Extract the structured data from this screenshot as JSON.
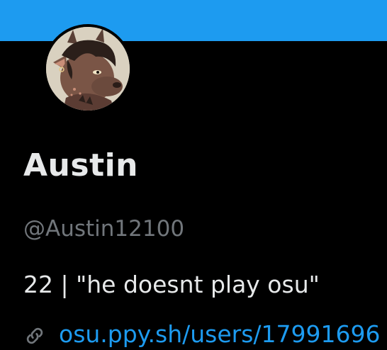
{
  "profile": {
    "display_name": "Austin",
    "handle": "@Austin12100",
    "bio": "22 | \"he doesnt play osu\"",
    "link_text": "osu.ppy.sh/users/17991696"
  },
  "icons": {
    "avatar": "avatar-image",
    "link": "link-icon"
  },
  "colors": {
    "banner": "#1d9bf0",
    "background": "#000000",
    "primary_text": "#e7e9ea",
    "secondary_text": "#71767b",
    "link": "#1d9bf0"
  }
}
